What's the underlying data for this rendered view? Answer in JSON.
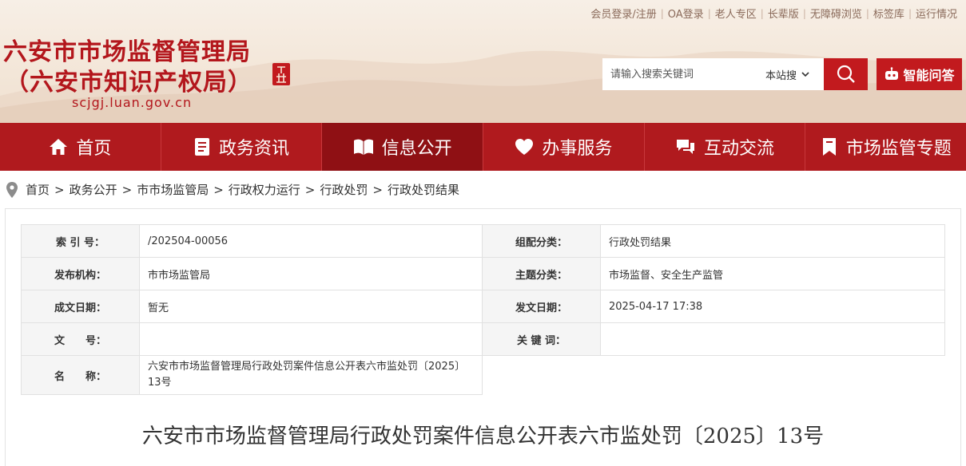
{
  "top_links": [
    "会员登录/注册",
    "OA登录",
    "老人专区",
    "长辈版",
    "无障碍浏览",
    "标签库",
    "运行情况"
  ],
  "site": {
    "title_line1": "六安市市场监督管理局",
    "title_line2": "（六安市知识产权局）",
    "domain": "scjgj.luan.gov.cn"
  },
  "search": {
    "placeholder": "请输入搜索关键词",
    "scope": "本站搜",
    "ai_label": "智能问答"
  },
  "nav": [
    {
      "label": "首页",
      "icon": "home-icon"
    },
    {
      "label": "政务资讯",
      "icon": "document-icon"
    },
    {
      "label": "信息公开",
      "icon": "open-book-icon",
      "active": true
    },
    {
      "label": "办事服务",
      "icon": "heart-icon"
    },
    {
      "label": "互动交流",
      "icon": "chat-icon"
    },
    {
      "label": "市场监管专题",
      "icon": "bookmark-icon"
    }
  ],
  "breadcrumb": [
    "首页",
    "政务公开",
    "市市场监管局",
    "行政权力运行",
    "行政处罚",
    "行政处罚结果"
  ],
  "meta": {
    "index_label": "索 引 号：",
    "index_value": "/202504-00056",
    "category_label": "组配分类：",
    "category_value": "行政处罚结果",
    "publisher_label": "发布机构：",
    "publisher_value": "市市场监管局",
    "topic_label": "主题分类：",
    "topic_value": "市场监督、安全生产监管",
    "created_label": "成文日期：",
    "created_value": "暂无",
    "published_label": "发文日期：",
    "published_value": "2025-04-17 17:38",
    "docno_label": "文　　号：",
    "docno_value": "",
    "keywords_label": "关 键 词：",
    "keywords_value": "",
    "name_label": "名　　称：",
    "name_value": "六安市市场监督管理局行政处罚案件信息公开表六市监处罚〔2025〕13号"
  },
  "article_title": "六安市市场监督管理局行政处罚案件信息公开表六市监处罚〔2025〕13号",
  "colors": {
    "brand_red": "#b01a1e",
    "nav_active": "#8f1014"
  }
}
